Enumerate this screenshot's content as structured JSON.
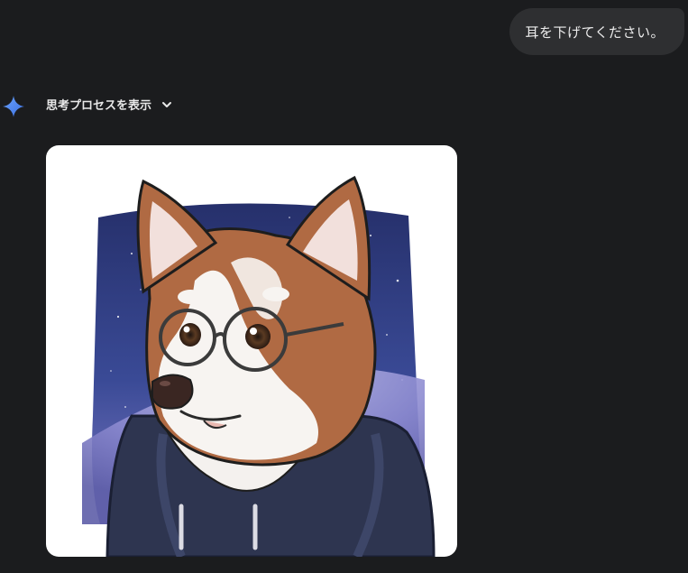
{
  "user_message": {
    "text": "耳を下げてください。"
  },
  "response": {
    "thinking_label": "思考プロセスを表示",
    "image": {
      "subject": "shiba-inu-in-glasses-and-navy-hoodie",
      "background": "space-with-earth-horizon"
    }
  },
  "icons": {
    "assistant": "gemini-spark-icon",
    "expand": "chevron-down-icon"
  },
  "colors": {
    "page_bg": "#1b1c1e",
    "bubble_bg": "#2e2f31",
    "spark_blue": "#4f8df6",
    "fur": "#b06a43",
    "hoodie": "#2e3550"
  }
}
